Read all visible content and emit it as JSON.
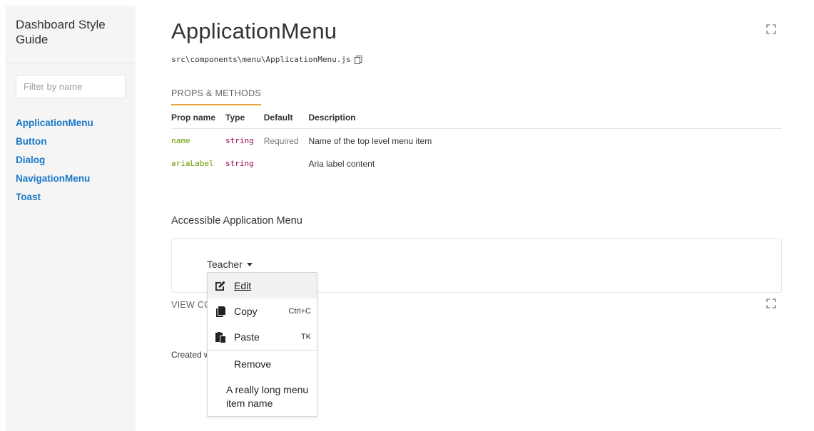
{
  "sidebar": {
    "title": "Dashboard Style Guide",
    "filter_placeholder": "Filter by name",
    "items": [
      {
        "label": "ApplicationMenu"
      },
      {
        "label": "Button"
      },
      {
        "label": "Dialog"
      },
      {
        "label": "NavigationMenu"
      },
      {
        "label": "Toast"
      }
    ]
  },
  "main": {
    "title": "ApplicationMenu",
    "file_path": "src\\components\\menu\\ApplicationMenu.js",
    "props_tab": "PROPS & METHODS",
    "table": {
      "headers": [
        "Prop name",
        "Type",
        "Default",
        "Description"
      ],
      "rows": [
        {
          "name": "name",
          "type": "string",
          "default": "Required",
          "description": "Name of the top level menu item"
        },
        {
          "name": "ariaLabel",
          "type": "string",
          "default": "",
          "description": "Aria label content"
        }
      ]
    },
    "example_title": "Accessible Application Menu",
    "view_code": "VIEW CC",
    "created": "Created w"
  },
  "menu": {
    "trigger": "Teacher",
    "items": [
      {
        "label": "Edit",
        "icon": "edit-icon",
        "shortcut": ""
      },
      {
        "label": "Copy",
        "icon": "copy-icon",
        "shortcut": "Ctrl+C"
      },
      {
        "label": "Paste",
        "icon": "paste-icon",
        "shortcut": "TK"
      },
      {
        "label": "Remove"
      },
      {
        "label": "A really long menu item name"
      }
    ]
  },
  "colors": {
    "accent": "#e8a53a",
    "link": "#1978c8",
    "prop_name": "#669900",
    "prop_type": "#990055"
  }
}
